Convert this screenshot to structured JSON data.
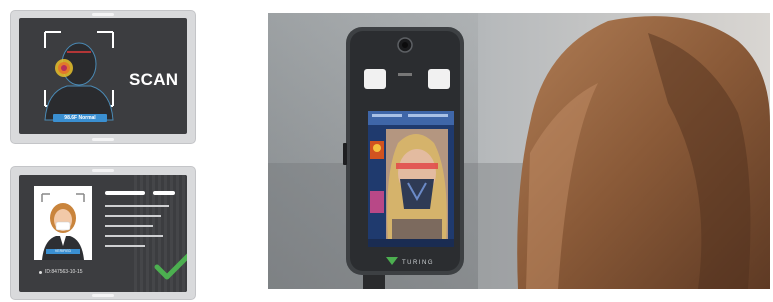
{
  "scan_card": {
    "title": "SCAN",
    "status_label": "98.6F Normal"
  },
  "id_card": {
    "id_number": "ID:847563-10-15",
    "photo_caption": "VERIFIED",
    "brand_accent": "#5cb85c"
  },
  "kiosk": {
    "brand": "TURING"
  },
  "colors": {
    "tablet_frame": "#d9dadc",
    "screen_dark": "#3c3d40",
    "check_green": "#4caf50",
    "status_blue": "#3a8fd1"
  }
}
